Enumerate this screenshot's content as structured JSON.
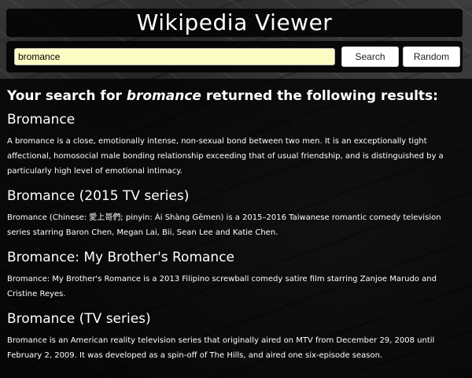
{
  "header": {
    "title": "Wikipedia Viewer"
  },
  "search": {
    "value": "bromance",
    "search_button_label": "Search",
    "random_button_label": "Random"
  },
  "results_heading": {
    "prefix": "Your search for ",
    "term": "bromance",
    "suffix": " returned the following results:"
  },
  "results": [
    {
      "title": "Bromance",
      "snippet": "A bromance is a close, emotionally intense, non-sexual bond between two men. It is an exceptionally tight affectional, homosocial male bonding relationship exceeding that of usual friendship, and is distinguished by a particularly high level of emotional intimacy."
    },
    {
      "title": "Bromance (2015 TV series)",
      "snippet": "Bromance (Chinese: 愛上哥們; pinyin: Ài Shàng Gēmen) is a 2015–2016 Taiwanese romantic comedy television series starring Baron Chen, Megan Lai, Bii, Sean Lee and Katie Chen."
    },
    {
      "title": "Bromance: My Brother's Romance",
      "snippet": "Bromance: My Brother's Romance is a 2013 Filipino screwball comedy satire film starring Zanjoe Marudo and Cristine Reyes."
    },
    {
      "title": "Bromance (TV series)",
      "snippet": "Bromance is an American reality television series that originally aired on MTV from December 29, 2008 until February 2, 2009. It was developed as a spin-off of The Hills, and aired one six-episode season."
    }
  ]
}
